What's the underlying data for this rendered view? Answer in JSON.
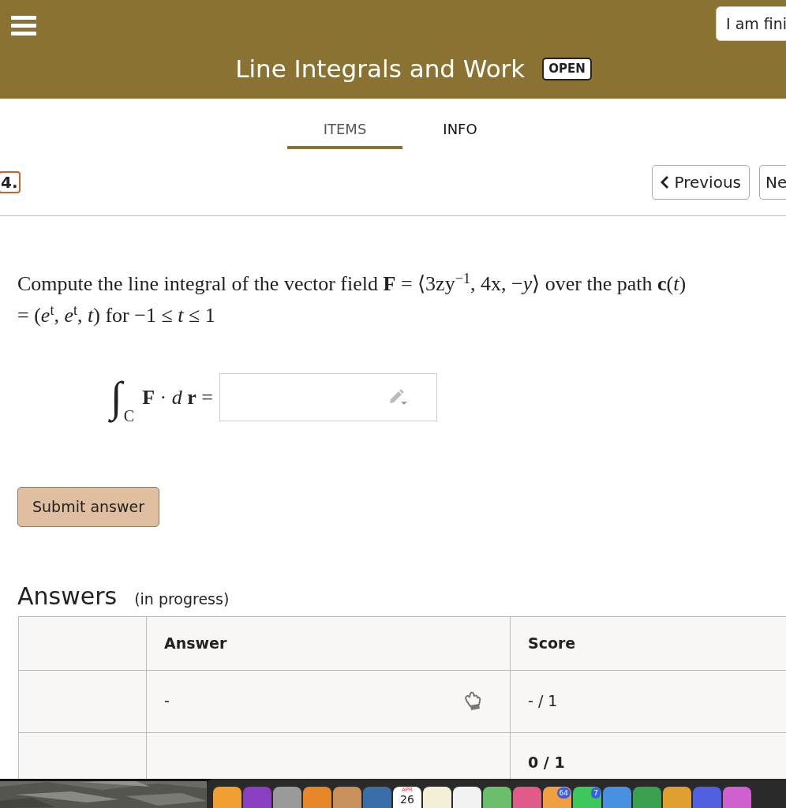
{
  "header": {
    "finish_button": "I am fini",
    "title": "Line Integrals and Work",
    "status_badge": "OPEN"
  },
  "tabs": [
    {
      "label": "ITEMS",
      "selected": true
    },
    {
      "label": "INFO",
      "selected": false
    }
  ],
  "item": {
    "number": "4.",
    "previous_button": "Previous",
    "next_button": "Ne"
  },
  "question": {
    "text": "Compute the line integral of the vector field **F** = ⟨3zy$^{−1}$, 4x, −*y*⟩ over the path **c**(*t*) = (*e*$^{t}$, *e*$^{t}$, *t*) for −1 ≤ *t* ≤ 1",
    "integral_symbol": "∫",
    "integral_subscript": "C",
    "equation_label": "**F** · *d* **r** ="
  },
  "submit_button": "Submit answer",
  "answers": {
    "title": "Answers",
    "status": "(in progress)",
    "columns": [
      "Answer",
      "Score"
    ],
    "rows": [
      {
        "answer": "-",
        "score": "- / 1",
        "kind": "attempt"
      },
      {
        "score": "0 / 1",
        "kind": "total"
      }
    ]
  },
  "dock": [
    {
      "kind": "app",
      "color": "#f0a030"
    },
    {
      "kind": "app",
      "color": "#8a3ec0"
    },
    {
      "kind": "app",
      "color": "#9a9a9a"
    },
    {
      "kind": "app",
      "color": "#e8862a"
    },
    {
      "kind": "app",
      "color": "#c8905a"
    },
    {
      "kind": "app",
      "color": "#3a6ea8"
    },
    {
      "kind": "calendar",
      "month": "APR",
      "day": "26"
    },
    {
      "kind": "app",
      "color": "#f4f0d8"
    },
    {
      "kind": "app",
      "color": "#f2f2f2"
    },
    {
      "kind": "app",
      "color": "#6bbf6b"
    },
    {
      "kind": "app",
      "color": "#e05a8a"
    },
    {
      "kind": "app",
      "color": "#f0a040",
      "badge": "64"
    },
    {
      "kind": "app",
      "color": "#3cc85a",
      "badge": "7"
    },
    {
      "kind": "app",
      "color": "#4a90e0"
    },
    {
      "kind": "app",
      "color": "#3aa050"
    },
    {
      "kind": "app",
      "color": "#e0a030"
    },
    {
      "kind": "app",
      "color": "#5060e0"
    },
    {
      "kind": "app",
      "color": "#d060d0"
    }
  ]
}
